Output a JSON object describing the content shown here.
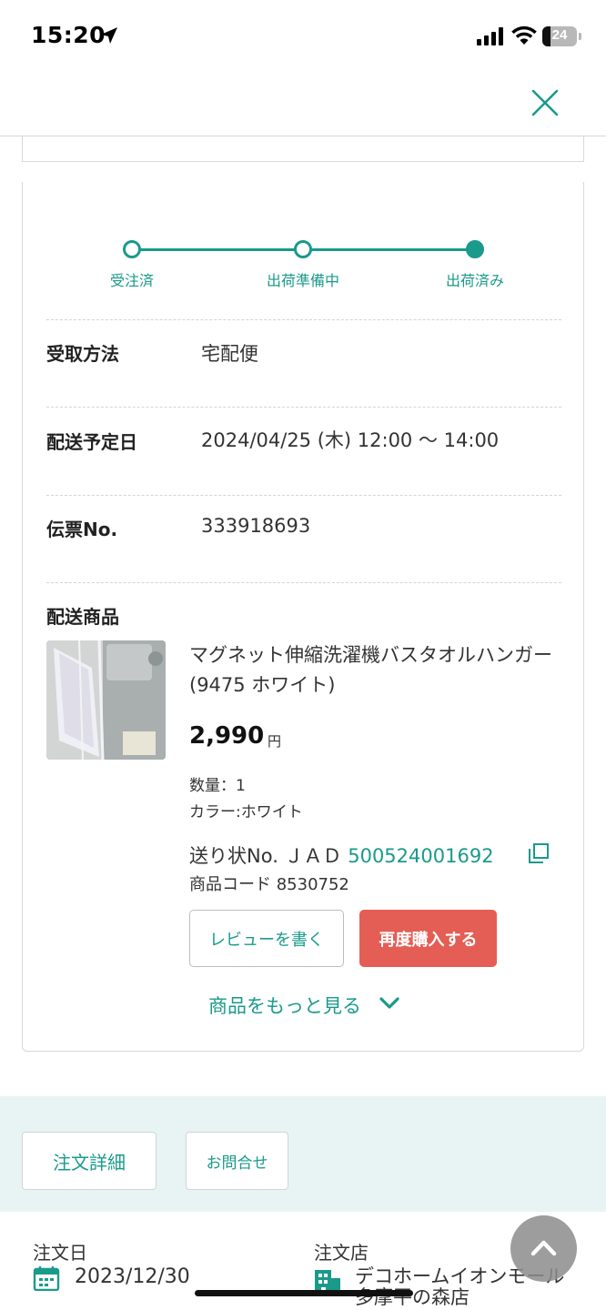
{
  "status_bar": {
    "time": "15:20",
    "battery": "24",
    "battery_level": 0.24
  },
  "progress": {
    "steps": [
      {
        "label": "受注済",
        "done": false
      },
      {
        "label": "出荷準備中",
        "done": false
      },
      {
        "label": "出荷済み",
        "done": true
      }
    ],
    "current_step": 3
  },
  "details": {
    "receive_method_label": "受取方法",
    "receive_method_value": "宅配便",
    "delivery_date_label": "配送予定日",
    "delivery_date_value": "2024/04/25 (木) 12:00 〜 14:00",
    "slip_label": "伝票No.",
    "slip_value": "333918693",
    "products_label": "配送商品"
  },
  "product": {
    "name": "マグネット伸縮洗濯機バスタオルハンガー(9475 ホワイト)",
    "price": "2,990",
    "price_unit": "円",
    "quantity": "数量：1",
    "color": "カラー:ホワイト",
    "invoice_prefix": "送り状No. ＪＡＤ ",
    "invoice_number": "500524001692",
    "code": "商品コード 8530752",
    "review_button": "レビューを書く",
    "rebuy_button": "再度購入する"
  },
  "more_link": "商品をもっと見る",
  "actions": {
    "detail_button": "注文詳細",
    "contact_button": "お問合せ"
  },
  "order": {
    "date_label": "注文日",
    "date_value": "2023/12/30",
    "store_label": "注文店",
    "store_value_line1": "デコホームイオンモール",
    "store_value_line2": "多摩平の森店"
  },
  "colors": {
    "accent": "#1a9a8b",
    "rebuy": "#e45e55",
    "band": "#e8f4f3"
  }
}
